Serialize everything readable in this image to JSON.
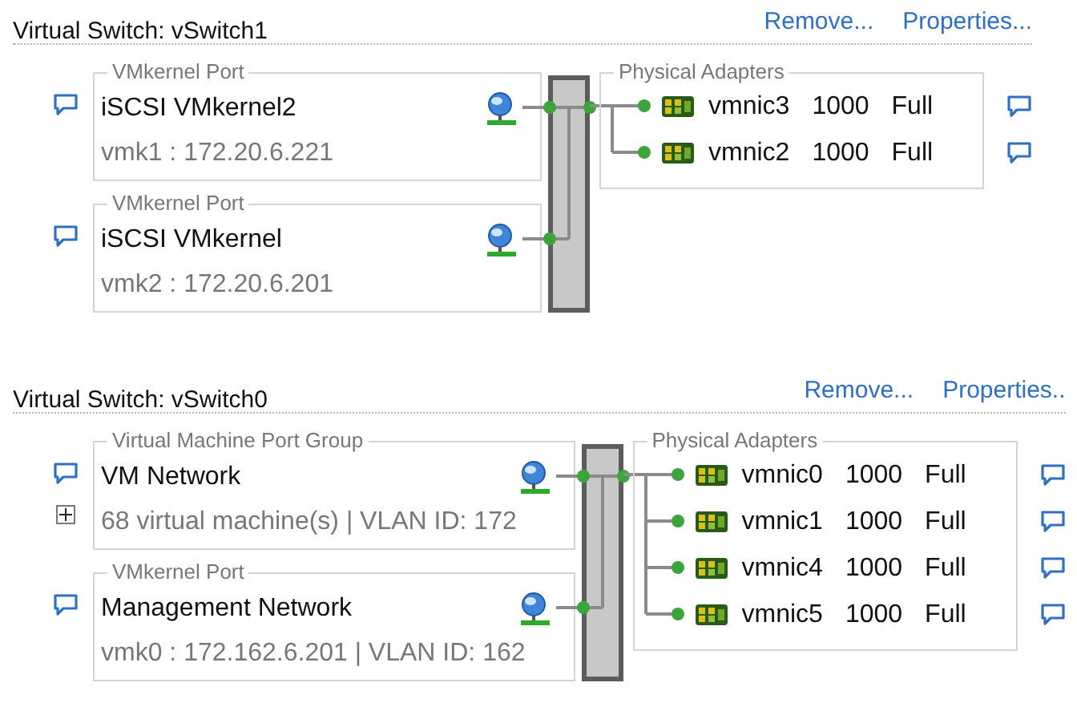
{
  "switches": [
    {
      "title": "Virtual Switch: vSwitch1",
      "actions": [
        "Remove...",
        "Properties..."
      ],
      "port_groups": [
        {
          "label": "VMkernel Port",
          "name": "iSCSI VMkernel2",
          "detail": "vmk1 : 172.20.6.221"
        },
        {
          "label": "VMkernel Port",
          "name": "iSCSI VMkernel",
          "detail": "vmk2 : 172.20.6.201"
        }
      ],
      "adapters_label": "Physical Adapters",
      "adapters": [
        {
          "name": "vmnic3",
          "speed": "1000",
          "duplex": "Full"
        },
        {
          "name": "vmnic2",
          "speed": "1000",
          "duplex": "Full"
        }
      ]
    },
    {
      "title": "Virtual Switch: vSwitch0",
      "actions": [
        "Remove...",
        "Properties.."
      ],
      "port_groups": [
        {
          "label": "Virtual Machine Port Group",
          "name": "VM Network",
          "detail": "68 virtual machine(s) | VLAN ID: 172",
          "expanded": false
        },
        {
          "label": "VMkernel Port",
          "name": "Management Network",
          "detail": "vmk0 : 172.162.6.201 | VLAN ID: 162"
        }
      ],
      "adapters_label": "Physical Adapters",
      "adapters": [
        {
          "name": "vmnic0",
          "speed": "1000",
          "duplex": "Full"
        },
        {
          "name": "vmnic1",
          "speed": "1000",
          "duplex": "Full"
        },
        {
          "name": "vmnic4",
          "speed": "1000",
          "duplex": "Full"
        },
        {
          "name": "vmnic5",
          "speed": "1000",
          "duplex": "Full"
        }
      ]
    }
  ]
}
